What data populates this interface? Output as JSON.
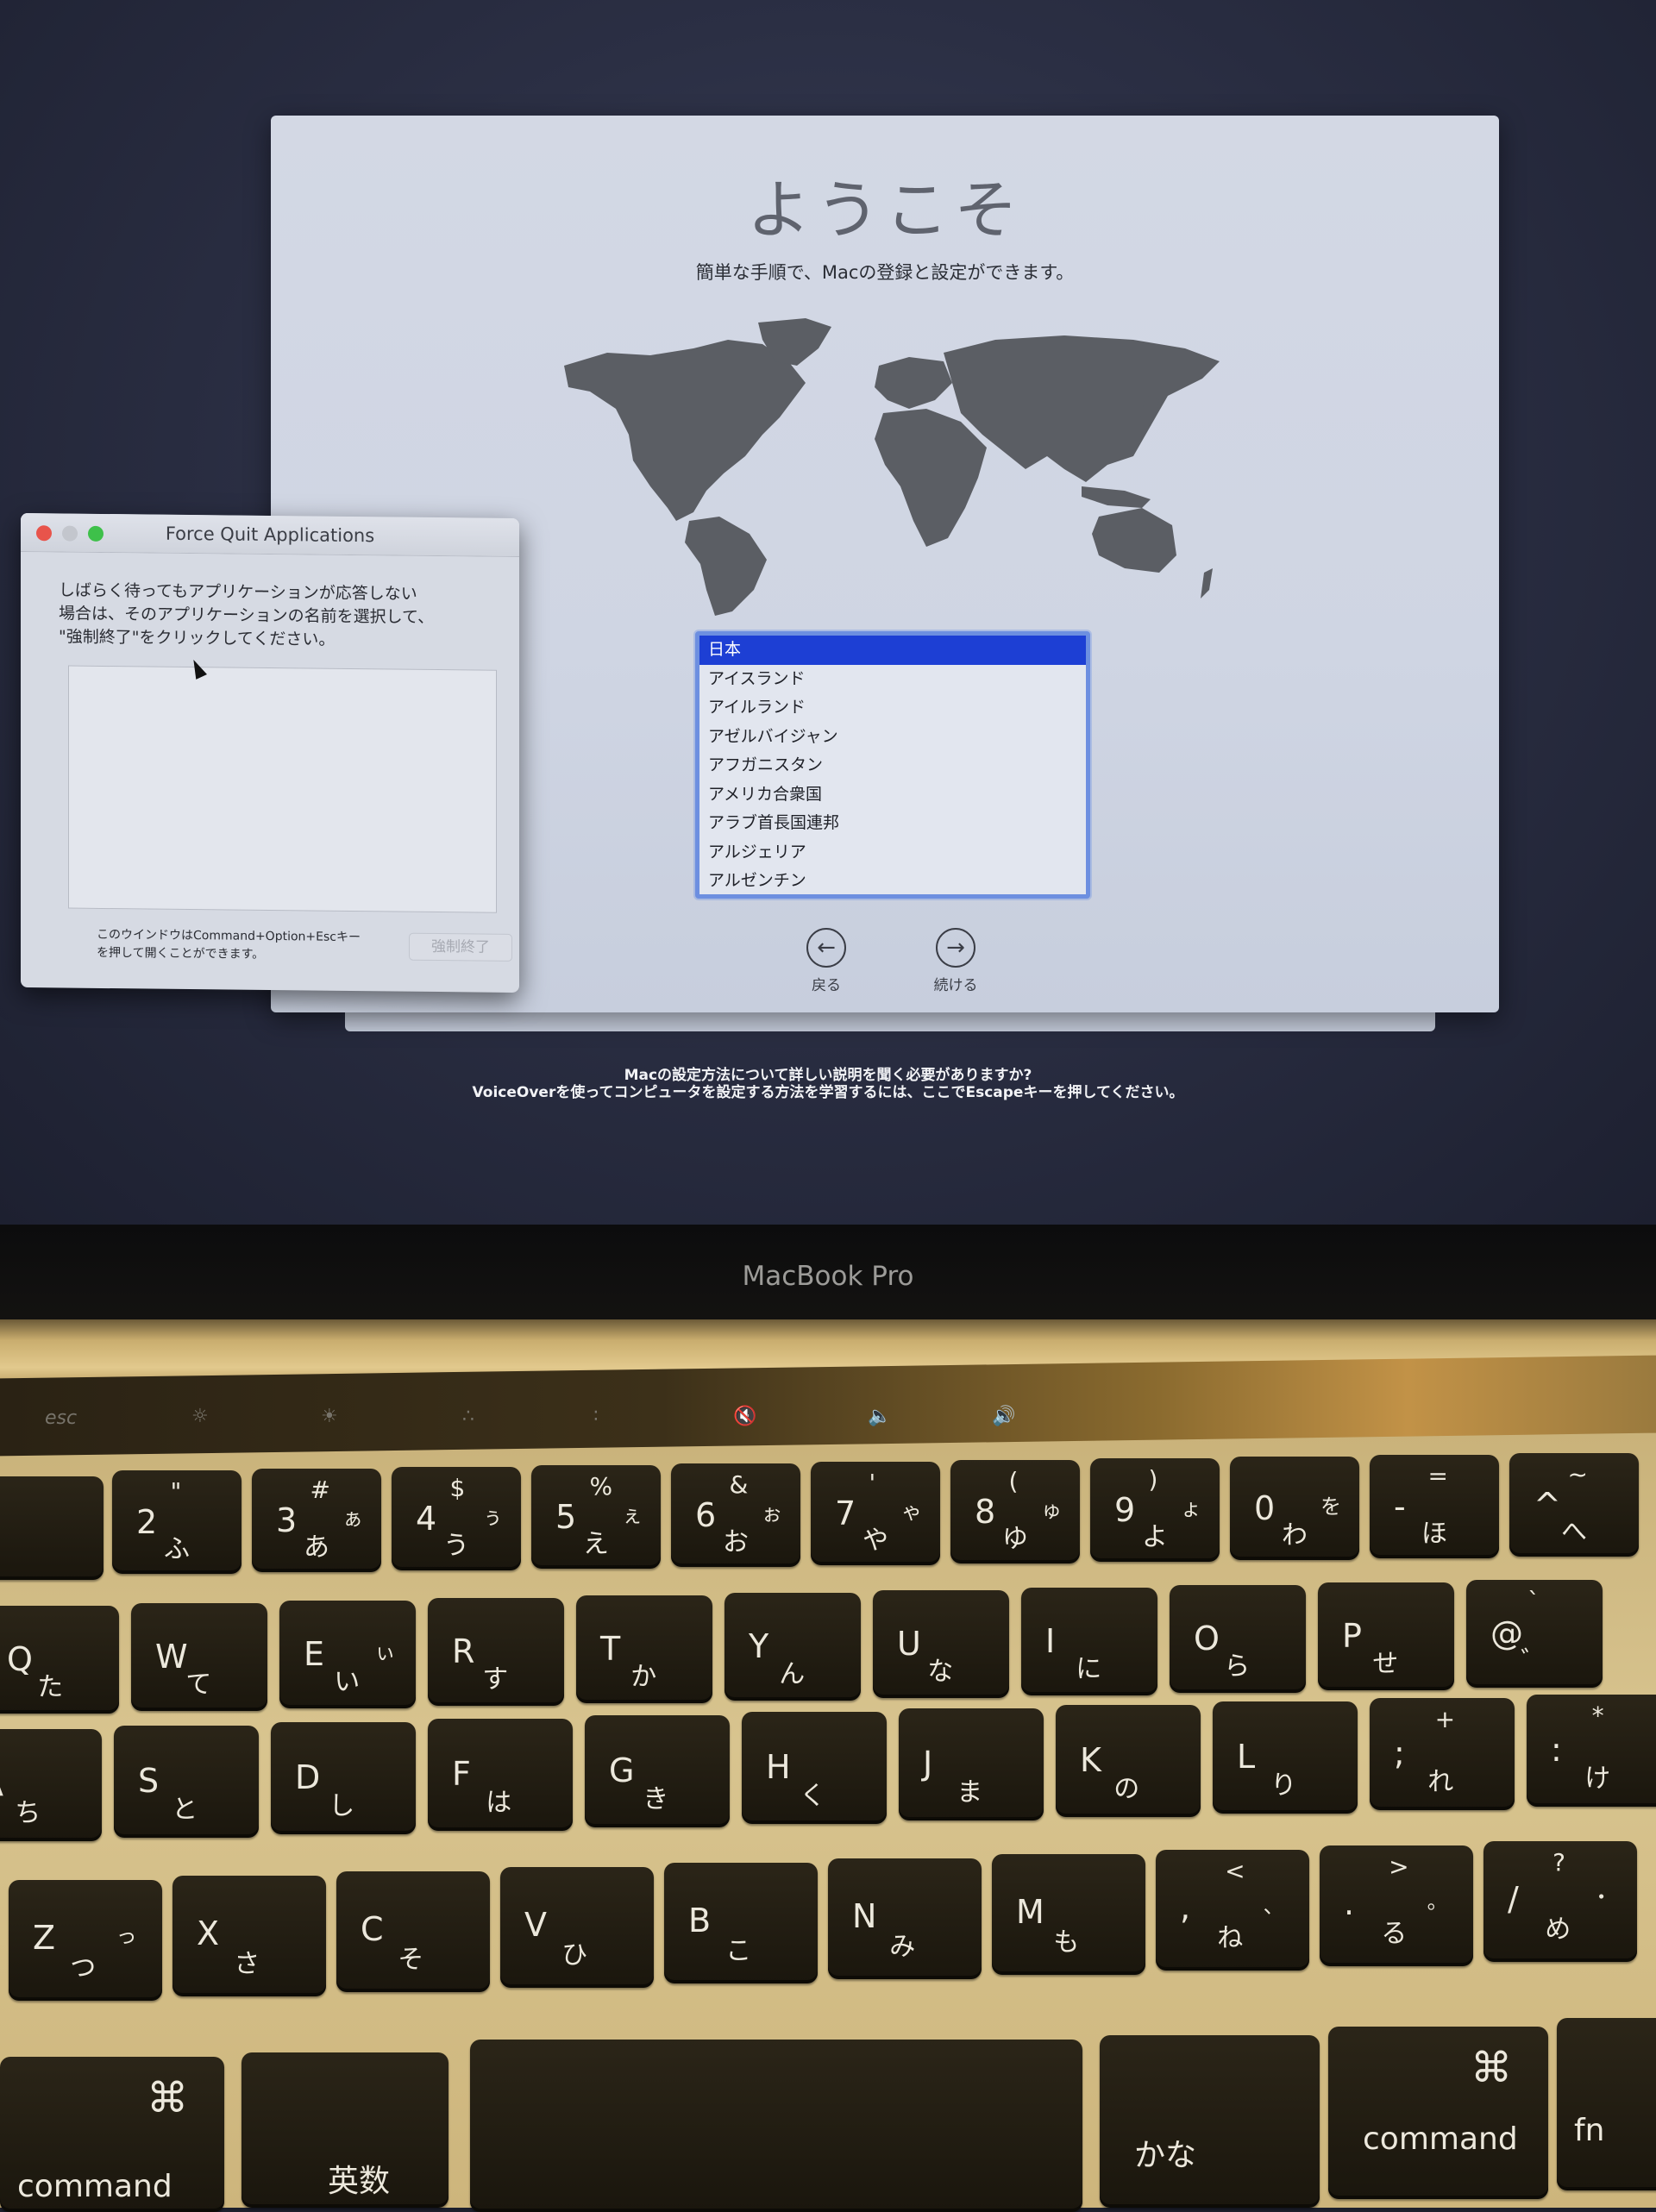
{
  "setup": {
    "title": "ようこそ",
    "subtitle": "簡単な手順で、Macの登録と設定ができます。",
    "countries": [
      "日本",
      "アイスランド",
      "アイルランド",
      "アゼルバイジャン",
      "アフガニスタン",
      "アメリカ合衆国",
      "アラブ首長国連邦",
      "アルジェリア",
      "アルゼンチン"
    ],
    "selected_country": "日本",
    "back_label": "戻る",
    "continue_label": "続ける",
    "help_line1": "Macの設定方法について詳しい説明を聞く必要がありますか?",
    "help_line2": "VoiceOverを使ってコンピュータを設定する方法を学習するには、ここでEscapeキーを押してください。"
  },
  "force_quit": {
    "title": "Force Quit Applications",
    "message_line1": "しばらく待ってもアプリケーションが応答しない",
    "message_line2": "場合は、そのアプリケーションの名前を選択して、",
    "message_line3": "\"強制終了\"をクリックしてください。",
    "hint_line1": "このウインドウはCommand+Option+Escキー",
    "hint_line2": "を押して開くことができます。",
    "button_label": "強制終了",
    "button_enabled": false
  },
  "device": {
    "model": "MacBook Pro"
  },
  "touchbar": {
    "esc": "esc",
    "icons": [
      "brightness-down",
      "brightness-up",
      "keyboard-light-down",
      "keyboard-light-up",
      "mute",
      "volume-down",
      "volume-up"
    ]
  },
  "keyboard": {
    "row1": [
      {
        "main": "2",
        "top": "\"",
        "kana": "ふ",
        "kana2": ""
      },
      {
        "main": "3",
        "top": "#",
        "kana": "あ",
        "kana2": "ぁ"
      },
      {
        "main": "4",
        "top": "$",
        "kana": "う",
        "kana2": "ぅ"
      },
      {
        "main": "5",
        "top": "%",
        "kana": "え",
        "kana2": "ぇ"
      },
      {
        "main": "6",
        "top": "&",
        "kana": "お",
        "kana2": "ぉ"
      },
      {
        "main": "7",
        "top": "'",
        "kana": "や",
        "kana2": "ゃ"
      },
      {
        "main": "8",
        "top": "(",
        "kana": "ゆ",
        "kana2": "ゅ"
      },
      {
        "main": "9",
        "top": ")",
        "kana": "よ",
        "kana2": "ょ"
      },
      {
        "main": "0",
        "top": "",
        "kana": "わ",
        "kana2": "を"
      },
      {
        "main": "-",
        "top": "=",
        "kana": "ほ",
        "kana2": ""
      },
      {
        "main": "^",
        "top": "~",
        "kana": "へ",
        "kana2": ""
      }
    ],
    "row2": [
      {
        "main": "Q",
        "kana": "た",
        "kana2": ""
      },
      {
        "main": "W",
        "kana": "て",
        "kana2": ""
      },
      {
        "main": "E",
        "kana": "い",
        "kana2": "ぃ"
      },
      {
        "main": "R",
        "kana": "す",
        "kana2": ""
      },
      {
        "main": "T",
        "kana": "か",
        "kana2": ""
      },
      {
        "main": "Y",
        "kana": "ん",
        "kana2": ""
      },
      {
        "main": "U",
        "kana": "な",
        "kana2": ""
      },
      {
        "main": "I",
        "kana": "に",
        "kana2": ""
      },
      {
        "main": "O",
        "kana": "ら",
        "kana2": ""
      },
      {
        "main": "P",
        "kana": "せ",
        "kana2": ""
      },
      {
        "main": "@",
        "top": "`",
        "kana": "゛",
        "kana2": ""
      }
    ],
    "row3": [
      {
        "main": "A",
        "kana": "ち"
      },
      {
        "main": "S",
        "kana": "と"
      },
      {
        "main": "D",
        "kana": "し"
      },
      {
        "main": "F",
        "kana": "は"
      },
      {
        "main": "G",
        "kana": "き"
      },
      {
        "main": "H",
        "kana": "く"
      },
      {
        "main": "J",
        "kana": "ま"
      },
      {
        "main": "K",
        "kana": "の"
      },
      {
        "main": "L",
        "kana": "り"
      },
      {
        "main": ";",
        "top": "+",
        "kana": "れ"
      },
      {
        "main": ":",
        "top": "*",
        "kana": "け"
      }
    ],
    "row4": [
      {
        "main": "Z",
        "kana": "つ",
        "kana2": "っ"
      },
      {
        "main": "X",
        "kana": "さ"
      },
      {
        "main": "C",
        "kana": "そ"
      },
      {
        "main": "V",
        "kana": "ひ"
      },
      {
        "main": "B",
        "kana": "こ"
      },
      {
        "main": "N",
        "kana": "み"
      },
      {
        "main": "M",
        "kana": "も"
      },
      {
        "main": ",",
        "top": "<",
        "kana": "ね",
        "kana2": "、"
      },
      {
        "main": ".",
        "top": ">",
        "kana": "る",
        "kana2": "。"
      },
      {
        "main": "/",
        "top": "?",
        "kana": "め",
        "kana2": "・"
      }
    ],
    "row5": {
      "command_left": "command",
      "command_symbol": "⌘",
      "eisu": "英数",
      "kana": "かな",
      "command_right": "command",
      "fn": "fn"
    }
  }
}
